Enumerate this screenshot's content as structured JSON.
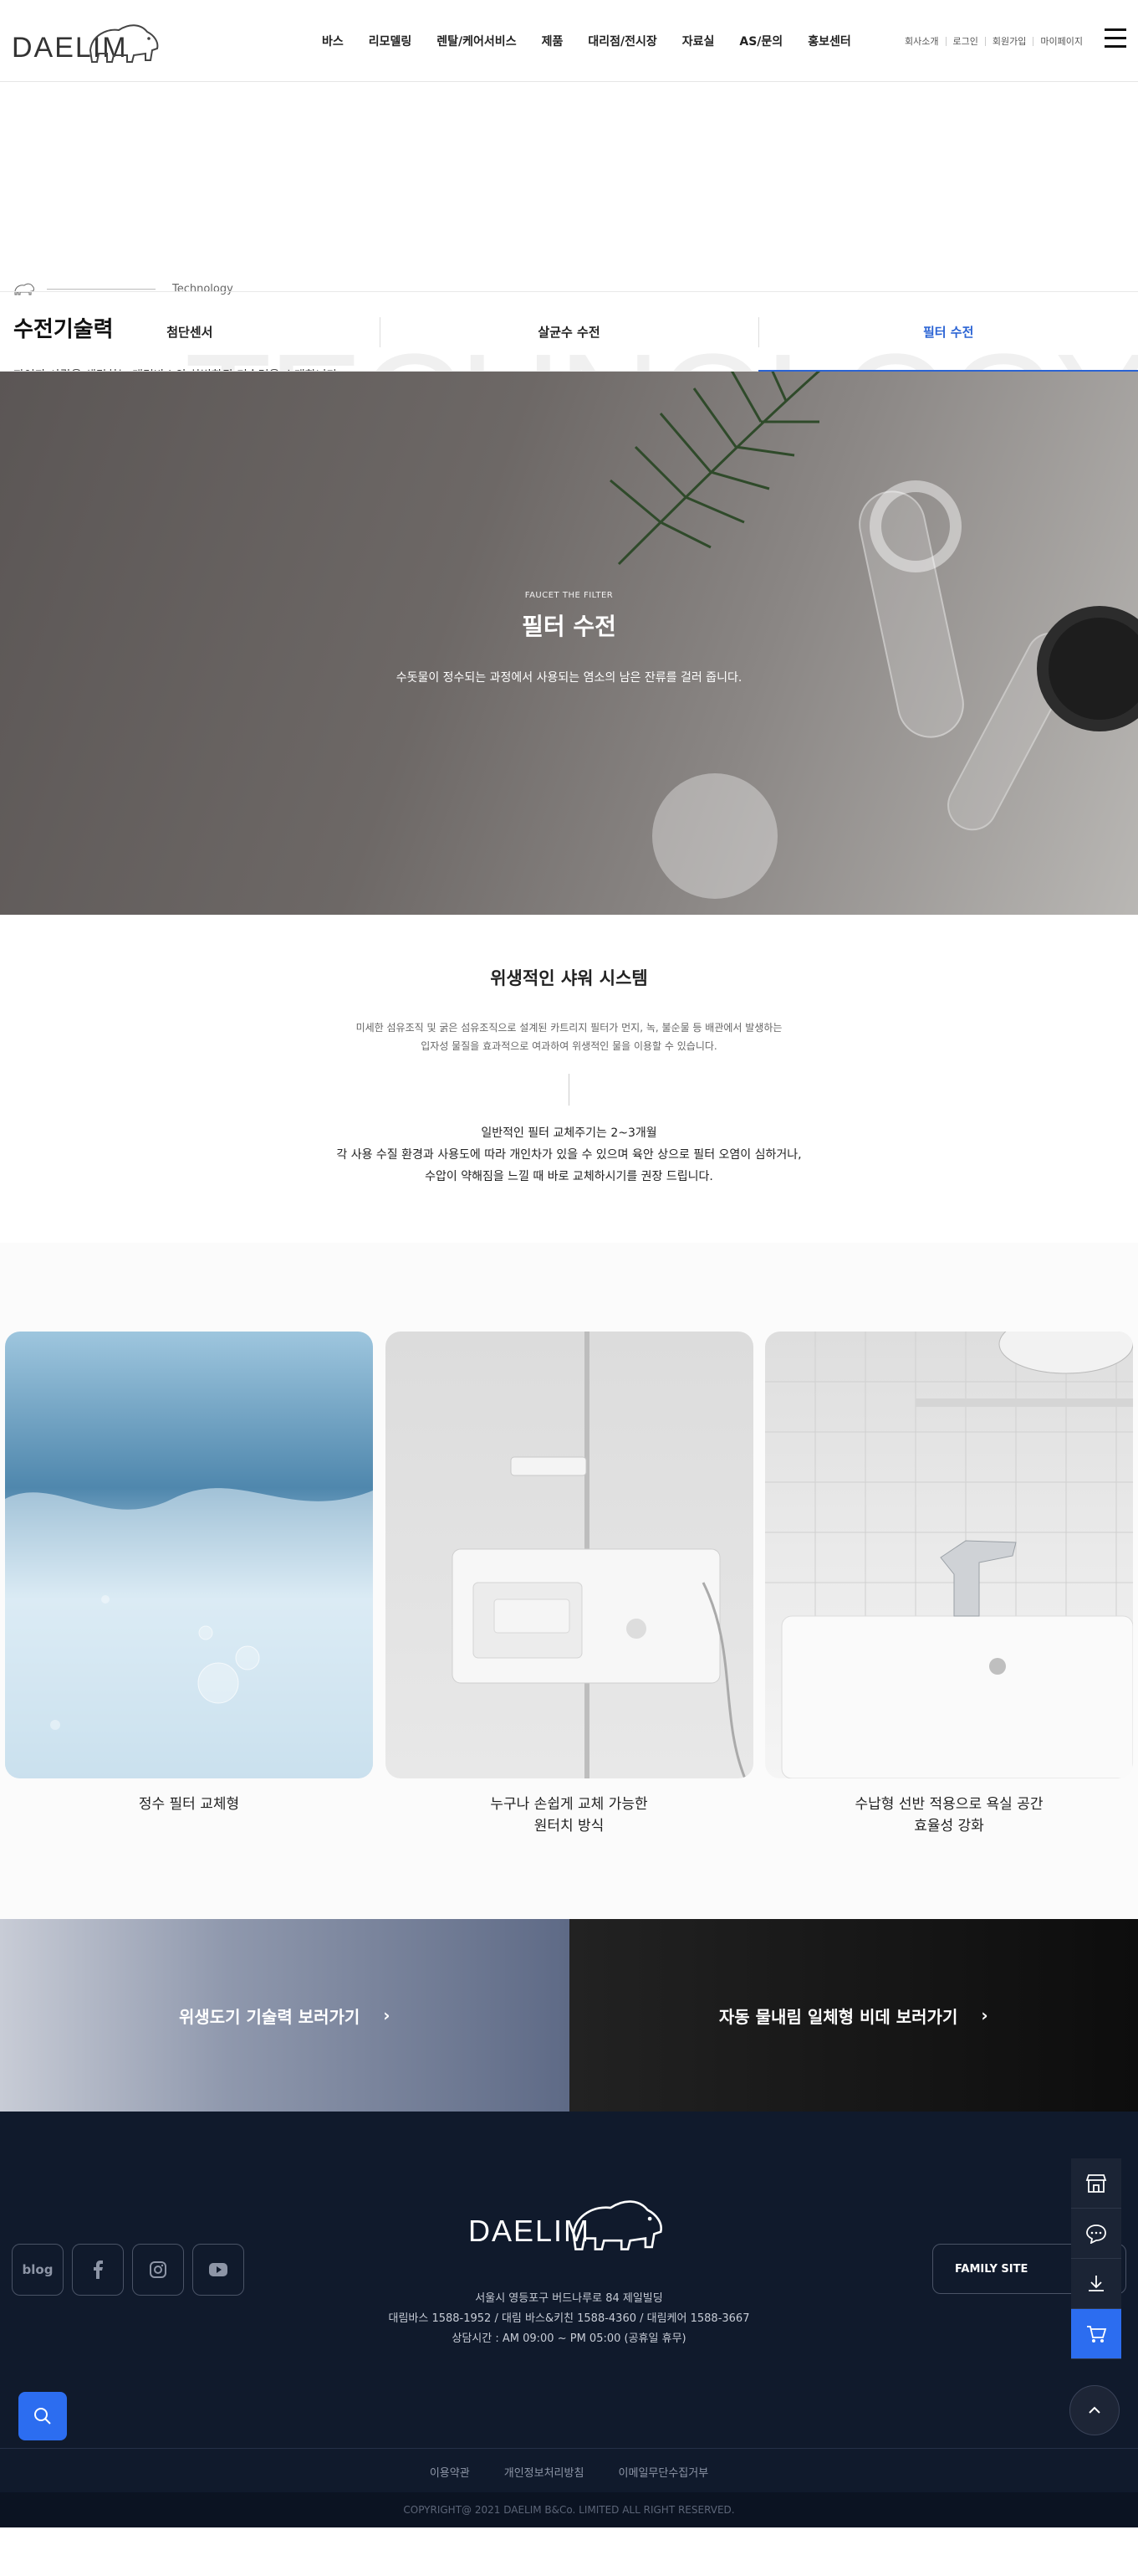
{
  "header": {
    "logo_text": "DAELIM",
    "nav": [
      "바스",
      "리모델링",
      "렌탈/케어서비스",
      "제품",
      "대리점/전시장",
      "자료실",
      "AS/문의",
      "홍보센터"
    ],
    "util": [
      "회사소개",
      "로그인",
      "회원가입",
      "마이페이지"
    ]
  },
  "title_area": {
    "crumb": "Technology",
    "title": "수전기술력",
    "desc": "자연과 사람을 생각하는 대림바스의 차별화된 기술력을 소개합니다.",
    "bg_word": "TECHNOLOGY"
  },
  "tabs": [
    {
      "label": "첨단센서",
      "active": false
    },
    {
      "label": "살균수 수전",
      "active": false
    },
    {
      "label": "필터 수전",
      "active": true
    }
  ],
  "hero": {
    "subtitle": "FAUCET THE FILTER",
    "title": "필터 수전",
    "desc": "수돗물이 정수되는 과정에서 사용되는 염소의 남은 잔류를 걸러 줍니다."
  },
  "system": {
    "title": "위생적인 샤워 시스템",
    "p1_line1": "미세한 섬유조직 및 굵은 섬유조직으로 설계된 카트리지 필터가 먼지, 녹, 불순물 등 배관에서 발생하는",
    "p1_line2": "입자성 물질을 효과적으로 여과하여 위생적인 물을 이용할 수 있습니다.",
    "p2_line1": "일반적인 필터 교체주기는 2~3개월",
    "p2_line2": "각 사용 수질 환경과 사용도에 따라 개인차가 있을 수 있으며 육안 상으로 필터 오염이 심하거나,",
    "p2_line3": "수압이 약해짐을 느낄 때 바로 교체하시기를 권장 드립니다."
  },
  "cards": [
    {
      "label_line1": "정수 필터 교체형",
      "label_line2": ""
    },
    {
      "label_line1": "누구나 손쉽게 교체 가능한",
      "label_line2": "원터치 방식"
    },
    {
      "label_line1": "수납형 선반 적용으로 욕실 공간",
      "label_line2": "효율성 강화"
    }
  ],
  "banners": {
    "left": "위생도기 기술력 보러가기",
    "right": "자동 물내림 일체형 비데 보러가기"
  },
  "footer": {
    "logo_text": "DAELIM",
    "sns": [
      "blog",
      "facebook-icon",
      "instagram-icon",
      "youtube-icon"
    ],
    "sns_blog_label": "blog",
    "family_site": "FAMILY SITE",
    "address": "서울시 영등포구 버드나루로 84 제일빌딩",
    "phones": "대림바스 1588-1952 / 대림 바스&키친 1588-4360 / 대림케어 1588-3667",
    "hours": "상담시간 : AM 09:00 ~ PM 05:00 (공휴일 휴무)",
    "links": [
      "이용약관",
      "개인정보처리방침",
      "이메일무단수집거부"
    ],
    "copyright": "COPYRIGHT@ 2021 DAELIM B&Co. LIMITED ALL RIGHT RESERVED."
  },
  "colors": {
    "accent": "#2a63d4",
    "footer_bg": "#101a2c",
    "fab_blue": "#2c6df0"
  }
}
